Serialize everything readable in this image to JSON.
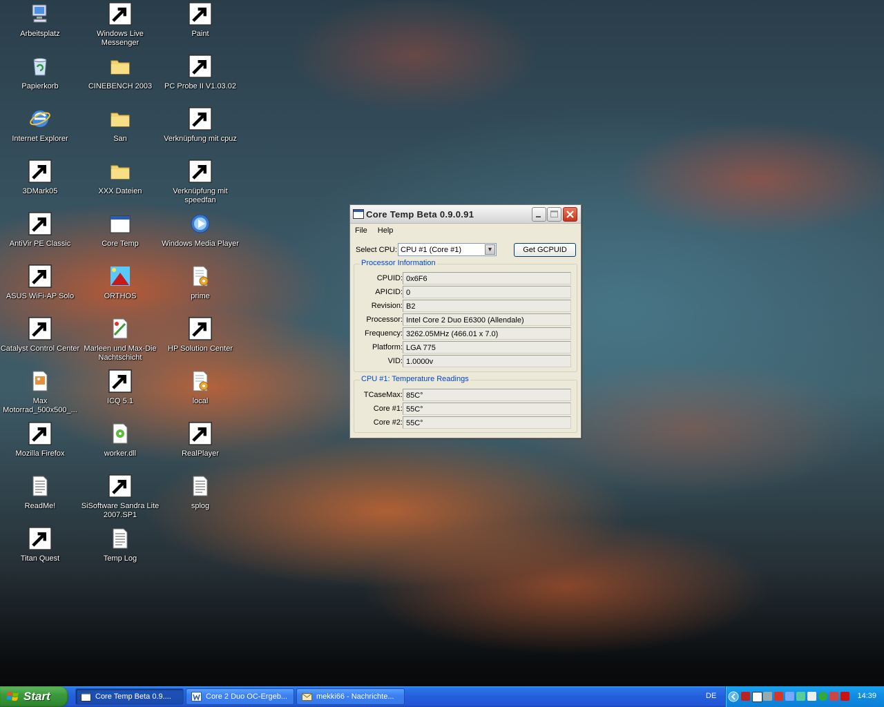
{
  "desktop": {
    "icons": [
      {
        "label": "Arbeitsplatz",
        "icon": "computer-icon"
      },
      {
        "label": "Windows Live Messenger",
        "icon": "messenger-icon"
      },
      {
        "label": "Paint",
        "icon": "paint-icon"
      },
      {
        "label": "Papierkorb",
        "icon": "recycle-bin-icon"
      },
      {
        "label": "CINEBENCH 2003",
        "icon": "folder-icon"
      },
      {
        "label": "PC Probe II V1.03.02",
        "icon": "pc-probe-icon"
      },
      {
        "label": "Internet Explorer",
        "icon": "internet-explorer-icon"
      },
      {
        "label": "San",
        "icon": "folder-icon"
      },
      {
        "label": "Verknüpfung mit cpuz",
        "icon": "cpuz-icon"
      },
      {
        "label": "3DMark05",
        "icon": "3dmark-icon"
      },
      {
        "label": "XXX Dateien",
        "icon": "folder-icon"
      },
      {
        "label": "Verknüpfung mit speedfan",
        "icon": "speedfan-icon"
      },
      {
        "label": "AntiVir PE Classic",
        "icon": "antivir-icon"
      },
      {
        "label": "Core Temp",
        "icon": "window-icon"
      },
      {
        "label": "Windows Media Player",
        "icon": "media-player-icon"
      },
      {
        "label": "ASUS WiFi-AP Solo",
        "icon": "wifi-icon"
      },
      {
        "label": "ORTHOS",
        "icon": "orthos-icon"
      },
      {
        "label": "prime",
        "icon": "config-file-icon"
      },
      {
        "label": "Catalyst Control Center",
        "icon": "ati-icon"
      },
      {
        "label": "Marleen und Max-Die Nachtschicht",
        "icon": "media-file-icon"
      },
      {
        "label": "HP Solution Center",
        "icon": "hp-solution-icon"
      },
      {
        "label": "Max Motorrad_500x500_...",
        "icon": "image-file-icon"
      },
      {
        "label": "ICQ 5.1",
        "icon": "icq-icon"
      },
      {
        "label": "local",
        "icon": "config-file-icon"
      },
      {
        "label": "Mozilla Firefox",
        "icon": "firefox-icon"
      },
      {
        "label": "worker.dll",
        "icon": "dll-file-icon"
      },
      {
        "label": "RealPlayer",
        "icon": "realplayer-icon"
      },
      {
        "label": "ReadMe!",
        "icon": "text-file-icon"
      },
      {
        "label": "SiSoftware Sandra Lite 2007.SP1",
        "icon": "sandra-icon"
      },
      {
        "label": "splog",
        "icon": "text-file-icon"
      },
      {
        "label": "Titan Quest",
        "icon": "titan-quest-icon"
      },
      {
        "label": "Temp Log",
        "icon": "text-file-icon"
      }
    ]
  },
  "window": {
    "title": "Core Temp Beta 0.9.0.91",
    "menu": [
      "File",
      "Help"
    ],
    "select_cpu_label": "Select CPU:",
    "select_cpu_value": "CPU #1 (Core #1)",
    "gcpuid_button": "Get GCPUID",
    "processor_info": {
      "title": "Processor Information",
      "rows": [
        {
          "label": "CPUID:",
          "value": "0x6F6"
        },
        {
          "label": "APICID:",
          "value": "0"
        },
        {
          "label": "Revision:",
          "value": "B2"
        },
        {
          "label": "Processor:",
          "value": "Intel Core 2 Duo E6300 (Allendale)"
        },
        {
          "label": "Frequency:",
          "value": "3262.05MHz (466.01 x 7.0)"
        },
        {
          "label": "Platform:",
          "value": "LGA 775"
        },
        {
          "label": "VID:",
          "value": "1.0000v"
        }
      ]
    },
    "temperature": {
      "title": "CPU #1: Temperature Readings",
      "rows": [
        {
          "label": "TCaseMax:",
          "value": "85C°"
        },
        {
          "label": "Core #1:",
          "value": "55C°"
        },
        {
          "label": "Core #2:",
          "value": "55C°"
        }
      ]
    }
  },
  "taskbar": {
    "start_label": "Start",
    "buttons": [
      {
        "label": "Core Temp Beta 0.9....",
        "icon": "window-icon",
        "active": true
      },
      {
        "label": "Core 2 Duo OC-Ergeb...",
        "icon": "word-icon",
        "active": false
      },
      {
        "label": "mekki66 - Nachrichte...",
        "icon": "mail-icon",
        "active": false
      }
    ],
    "language": "DE",
    "clock": "14:39"
  }
}
